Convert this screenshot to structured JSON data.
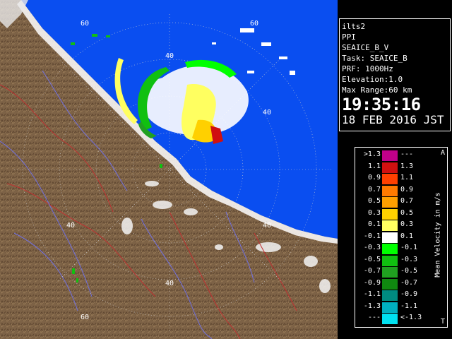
{
  "info": {
    "station": "ilts2",
    "mode": "PPI",
    "product": "SEAICE_B_V",
    "task": "Task: SEAICE_B",
    "prf": "PRF: 1000Hz",
    "elevation": "Elevation:1.0",
    "max_range": "Max Range:60 km",
    "time": "19:35:16",
    "date": "18 FEB 2016 JST"
  },
  "legend": {
    "title": "Mean Velocity in m/s",
    "corner_top": "A",
    "corner_bottom": "T",
    "rows": [
      {
        "left": ">1.3",
        "right": "---",
        "color": "#c0008a"
      },
      {
        "left": "1.1",
        "right": "1.3",
        "color": "#d01010"
      },
      {
        "left": "0.9",
        "right": "1.1",
        "color": "#ff4000"
      },
      {
        "left": "0.7",
        "right": "0.9",
        "color": "#ff7a00"
      },
      {
        "left": "0.5",
        "right": "0.7",
        "color": "#ffa000"
      },
      {
        "left": "0.3",
        "right": "0.5",
        "color": "#ffd000"
      },
      {
        "left": "0.1",
        "right": "0.3",
        "color": "#ffff60"
      },
      {
        "left": "-0.1",
        "right": "0.1",
        "color": "#ffffff"
      },
      {
        "left": "-0.3",
        "right": "-0.1",
        "color": "#00ff00"
      },
      {
        "left": "-0.5",
        "right": "-0.3",
        "color": "#10c010"
      },
      {
        "left": "-0.7",
        "right": "-0.5",
        "color": "#20a020"
      },
      {
        "left": "-0.9",
        "right": "-0.7",
        "color": "#108810"
      },
      {
        "left": "-1.1",
        "right": "-0.9",
        "color": "#008a80"
      },
      {
        "left": "-1.3",
        "right": "-1.1",
        "color": "#00b0c0"
      },
      {
        "left": "---",
        "right": "<-1.3",
        "color": "#00e0f0"
      }
    ]
  },
  "map": {
    "ring_labels": [
      "60",
      "60",
      "40",
      "40",
      "40",
      "40",
      "40",
      "60"
    ],
    "sea_color": "#0a4ef0",
    "land_color": "#7a5f42"
  }
}
